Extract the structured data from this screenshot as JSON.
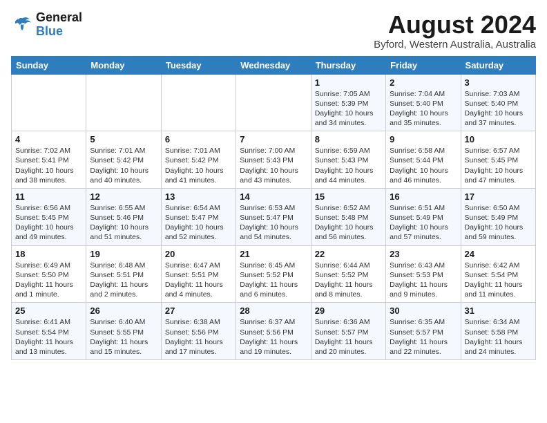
{
  "header": {
    "logo_line1": "General",
    "logo_line2": "Blue",
    "month": "August 2024",
    "location": "Byford, Western Australia, Australia"
  },
  "days_of_week": [
    "Sunday",
    "Monday",
    "Tuesday",
    "Wednesday",
    "Thursday",
    "Friday",
    "Saturday"
  ],
  "weeks": [
    [
      {
        "day": "",
        "info": ""
      },
      {
        "day": "",
        "info": ""
      },
      {
        "day": "",
        "info": ""
      },
      {
        "day": "",
        "info": ""
      },
      {
        "day": "1",
        "info": "Sunrise: 7:05 AM\nSunset: 5:39 PM\nDaylight: 10 hours\nand 34 minutes."
      },
      {
        "day": "2",
        "info": "Sunrise: 7:04 AM\nSunset: 5:40 PM\nDaylight: 10 hours\nand 35 minutes."
      },
      {
        "day": "3",
        "info": "Sunrise: 7:03 AM\nSunset: 5:40 PM\nDaylight: 10 hours\nand 37 minutes."
      }
    ],
    [
      {
        "day": "4",
        "info": "Sunrise: 7:02 AM\nSunset: 5:41 PM\nDaylight: 10 hours\nand 38 minutes."
      },
      {
        "day": "5",
        "info": "Sunrise: 7:01 AM\nSunset: 5:42 PM\nDaylight: 10 hours\nand 40 minutes."
      },
      {
        "day": "6",
        "info": "Sunrise: 7:01 AM\nSunset: 5:42 PM\nDaylight: 10 hours\nand 41 minutes."
      },
      {
        "day": "7",
        "info": "Sunrise: 7:00 AM\nSunset: 5:43 PM\nDaylight: 10 hours\nand 43 minutes."
      },
      {
        "day": "8",
        "info": "Sunrise: 6:59 AM\nSunset: 5:43 PM\nDaylight: 10 hours\nand 44 minutes."
      },
      {
        "day": "9",
        "info": "Sunrise: 6:58 AM\nSunset: 5:44 PM\nDaylight: 10 hours\nand 46 minutes."
      },
      {
        "day": "10",
        "info": "Sunrise: 6:57 AM\nSunset: 5:45 PM\nDaylight: 10 hours\nand 47 minutes."
      }
    ],
    [
      {
        "day": "11",
        "info": "Sunrise: 6:56 AM\nSunset: 5:45 PM\nDaylight: 10 hours\nand 49 minutes."
      },
      {
        "day": "12",
        "info": "Sunrise: 6:55 AM\nSunset: 5:46 PM\nDaylight: 10 hours\nand 51 minutes."
      },
      {
        "day": "13",
        "info": "Sunrise: 6:54 AM\nSunset: 5:47 PM\nDaylight: 10 hours\nand 52 minutes."
      },
      {
        "day": "14",
        "info": "Sunrise: 6:53 AM\nSunset: 5:47 PM\nDaylight: 10 hours\nand 54 minutes."
      },
      {
        "day": "15",
        "info": "Sunrise: 6:52 AM\nSunset: 5:48 PM\nDaylight: 10 hours\nand 56 minutes."
      },
      {
        "day": "16",
        "info": "Sunrise: 6:51 AM\nSunset: 5:49 PM\nDaylight: 10 hours\nand 57 minutes."
      },
      {
        "day": "17",
        "info": "Sunrise: 6:50 AM\nSunset: 5:49 PM\nDaylight: 10 hours\nand 59 minutes."
      }
    ],
    [
      {
        "day": "18",
        "info": "Sunrise: 6:49 AM\nSunset: 5:50 PM\nDaylight: 11 hours\nand 1 minute."
      },
      {
        "day": "19",
        "info": "Sunrise: 6:48 AM\nSunset: 5:51 PM\nDaylight: 11 hours\nand 2 minutes."
      },
      {
        "day": "20",
        "info": "Sunrise: 6:47 AM\nSunset: 5:51 PM\nDaylight: 11 hours\nand 4 minutes."
      },
      {
        "day": "21",
        "info": "Sunrise: 6:45 AM\nSunset: 5:52 PM\nDaylight: 11 hours\nand 6 minutes."
      },
      {
        "day": "22",
        "info": "Sunrise: 6:44 AM\nSunset: 5:52 PM\nDaylight: 11 hours\nand 8 minutes."
      },
      {
        "day": "23",
        "info": "Sunrise: 6:43 AM\nSunset: 5:53 PM\nDaylight: 11 hours\nand 9 minutes."
      },
      {
        "day": "24",
        "info": "Sunrise: 6:42 AM\nSunset: 5:54 PM\nDaylight: 11 hours\nand 11 minutes."
      }
    ],
    [
      {
        "day": "25",
        "info": "Sunrise: 6:41 AM\nSunset: 5:54 PM\nDaylight: 11 hours\nand 13 minutes."
      },
      {
        "day": "26",
        "info": "Sunrise: 6:40 AM\nSunset: 5:55 PM\nDaylight: 11 hours\nand 15 minutes."
      },
      {
        "day": "27",
        "info": "Sunrise: 6:38 AM\nSunset: 5:56 PM\nDaylight: 11 hours\nand 17 minutes."
      },
      {
        "day": "28",
        "info": "Sunrise: 6:37 AM\nSunset: 5:56 PM\nDaylight: 11 hours\nand 19 minutes."
      },
      {
        "day": "29",
        "info": "Sunrise: 6:36 AM\nSunset: 5:57 PM\nDaylight: 11 hours\nand 20 minutes."
      },
      {
        "day": "30",
        "info": "Sunrise: 6:35 AM\nSunset: 5:57 PM\nDaylight: 11 hours\nand 22 minutes."
      },
      {
        "day": "31",
        "info": "Sunrise: 6:34 AM\nSunset: 5:58 PM\nDaylight: 11 hours\nand 24 minutes."
      }
    ]
  ]
}
